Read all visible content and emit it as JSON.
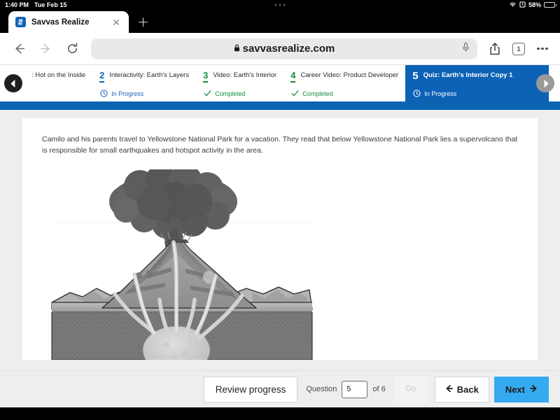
{
  "status_bar": {
    "time": "1:40 PM",
    "date": "Tue Feb 15",
    "wifi_icon": "wifi-icon",
    "alarm_icon": "alarm-icon",
    "battery_percent": "58%",
    "battery_level": 58,
    "multitask_handle": "multitask-dots-icon"
  },
  "browser": {
    "tab": {
      "title": "Savvas Realize",
      "favicon_letter": "S",
      "favicon_color": "#1464b4",
      "close_icon": "close-icon"
    },
    "new_tab_icon": "plus-icon",
    "back_icon": "arrow-left-icon",
    "forward_icon": "arrow-right-icon",
    "reload_icon": "reload-icon",
    "address": {
      "url": "savvasrealize.com",
      "lock_icon": "lock-icon",
      "mic_icon": "microphone-icon"
    },
    "share_icon": "share-icon",
    "tab_count": "1",
    "more_icon": "more-dots-icon"
  },
  "steps_nav": {
    "prev_arrow_icon": "chevron-left-icon",
    "next_arrow_icon": "chevron-right-icon",
    "current_color": "#0c62b5",
    "inprogress_color": "#1464b4",
    "completed_color": "#0f8f3b",
    "steps": [
      {
        "number": "",
        "label": ": Hot on the Inside",
        "status": "",
        "state": "truncated"
      },
      {
        "number": "2",
        "label": "Interactivity: Earth's Layers",
        "status": "In Progress",
        "state": "in-progress",
        "status_icon": "clock-icon"
      },
      {
        "number": "3",
        "label": "Video: Earth's Interior",
        "status": "Completed",
        "state": "completed",
        "status_icon": "check-icon"
      },
      {
        "number": "4",
        "label": "Career Video: Product Developer",
        "status": "Completed",
        "state": "completed",
        "status_icon": "check-icon"
      },
      {
        "number": "5",
        "label": "Quiz: Earth's Interior Copy 1",
        "status": "In Progress",
        "state": "current",
        "status_icon": "clock-icon"
      }
    ]
  },
  "content": {
    "prompt": "Camilo and his parents travel to Yellowstone National Park for a vacation. They read that below Yellowstone National Park lies a supervolcano that is responsible for small earthquakes and hotspot activity in the area.",
    "figure": {
      "name": "volcano-cross-section-diagram",
      "description": "Grayscale cross-section illustration of an erupting volcano with an ash plume, layered cone, surrounding terrain, subsurface magma chamber and branching conduits."
    }
  },
  "bottom_bar": {
    "review_label": "Review progress",
    "question_label": "Question",
    "question_value": "5",
    "of_label": "of 6",
    "go_label": "Go",
    "back_label": "Back",
    "back_icon": "arrow-left-icon",
    "next_label": "Next",
    "next_icon": "arrow-right-icon",
    "next_color": "#35aaf0"
  }
}
